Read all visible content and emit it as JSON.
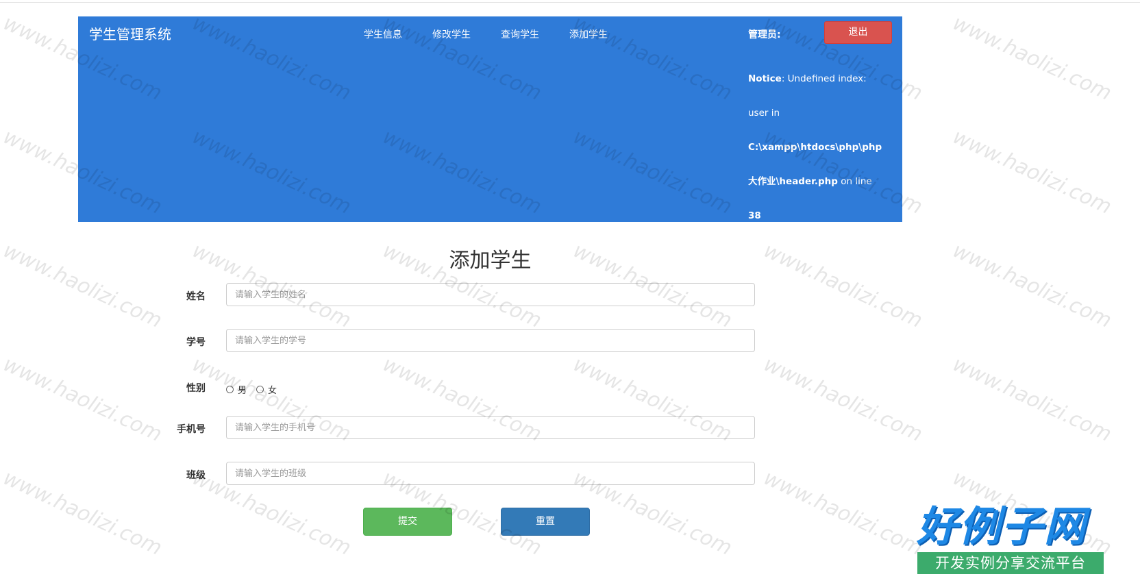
{
  "header": {
    "brand": "学生管理系统",
    "nav": [
      {
        "label": "学生信息"
      },
      {
        "label": "修改学生"
      },
      {
        "label": "查询学生"
      },
      {
        "label": "添加学生"
      }
    ],
    "admin_label": "管理员:",
    "logout_label": "退出",
    "notice": {
      "prefix": "Notice",
      "line1_rest": ": Undefined index:",
      "line2": "user in",
      "line3": "C:\\xampp\\htdocs\\php\\php",
      "line4_bold": "大作业\\header.php",
      "line4_rest": " on line",
      "line5": "38"
    }
  },
  "form": {
    "title": "添加学生",
    "name_label": "姓名",
    "name_placeholder": "请输入学生的姓名",
    "id_label": "学号",
    "id_placeholder": "请输入学生的学号",
    "gender_label": "性别",
    "gender_options": [
      {
        "label": "男"
      },
      {
        "label": "女"
      }
    ],
    "phone_label": "手机号",
    "phone_placeholder": "请输入学生的手机号",
    "class_label": "班级",
    "class_placeholder": "请输入学生的班级",
    "submit_label": "提交",
    "reset_label": "重置"
  },
  "watermark": {
    "text": "www.haolizi.com"
  },
  "logo": {
    "main": "好例子网",
    "sub": "开发实例分享交流平台",
    "main_color": "#1e88e5",
    "sub_bg": "#3cab6c"
  },
  "colors": {
    "navbar": "#2f7bd8",
    "logout": "#d9534f",
    "submit": "#5cb85c",
    "reset": "#337ab7"
  }
}
